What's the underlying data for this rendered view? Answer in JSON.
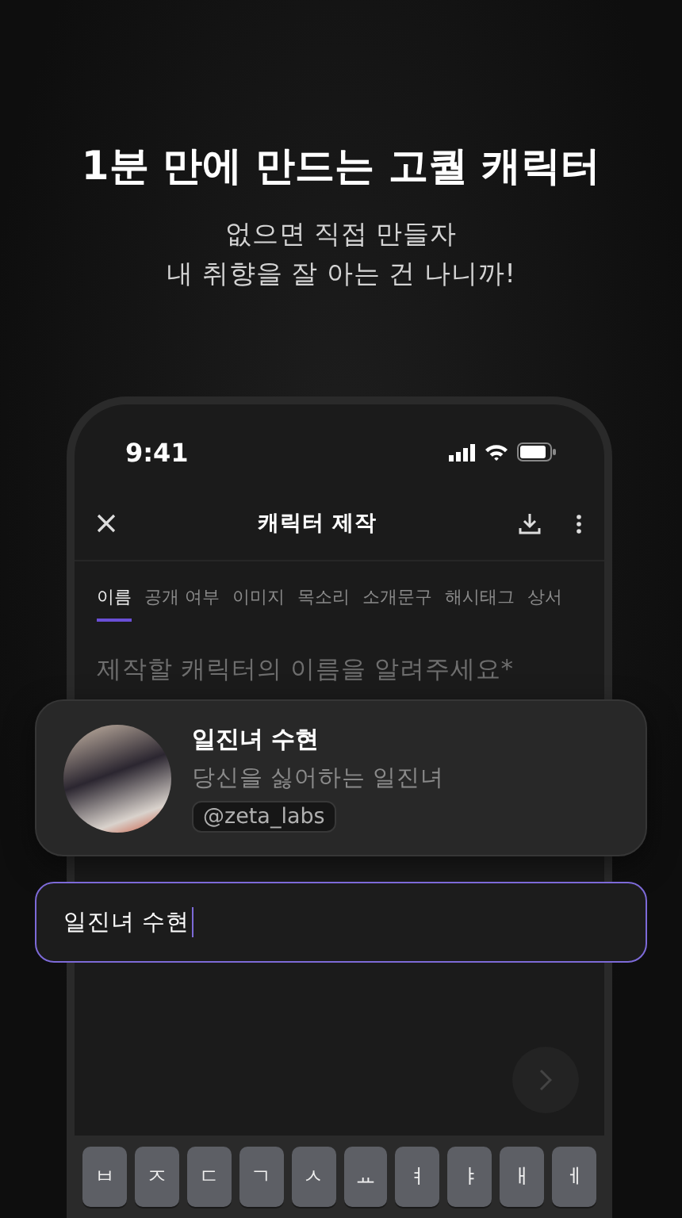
{
  "headline": "1분 만에 만드는 고퀄 캐릭터",
  "subtitle": [
    "없으면 직접 만들자",
    "내 취향을 잘 아는 건 나니까!"
  ],
  "status_bar": {
    "time": "9:41"
  },
  "header": {
    "title": "캐릭터 제작"
  },
  "tabs": [
    {
      "label": "이름",
      "selected": true
    },
    {
      "label": "공개 여부",
      "selected": false
    },
    {
      "label": "이미지",
      "selected": false
    },
    {
      "label": "목소리",
      "selected": false
    },
    {
      "label": "소개문구",
      "selected": false
    },
    {
      "label": "해시태그",
      "selected": false
    },
    {
      "label": "상서",
      "selected": false
    }
  ],
  "prompt": "제작할 캐릭터의 이름을 알려주세요*",
  "next_button": {
    "disabled": true
  },
  "character_card": {
    "name": "일진녀 수현",
    "description": "당신을 싫어하는 일진녀",
    "handle": "@zeta_labs"
  },
  "name_field": {
    "value": "일진녀 수현"
  },
  "keyboard": {
    "keys": [
      "ㅂ",
      "ㅈ",
      "ㄷ",
      "ㄱ",
      "ㅅ",
      "ㅛ",
      "ㅕ",
      "ㅑ",
      "ㅐ",
      "ㅔ"
    ]
  }
}
